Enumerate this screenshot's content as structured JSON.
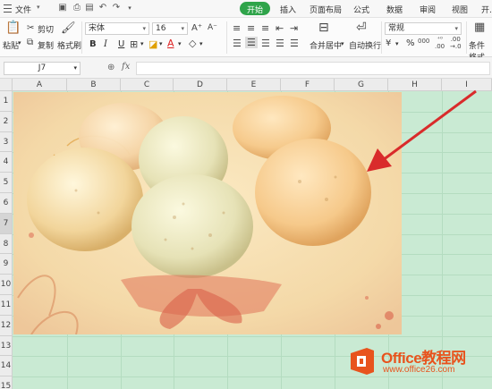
{
  "menubar": {
    "file_label": "文件",
    "tabs": [
      {
        "label": "开始",
        "active": true
      },
      {
        "label": "插入"
      },
      {
        "label": "页面布局"
      },
      {
        "label": "公式"
      },
      {
        "label": "数据"
      },
      {
        "label": "审阅"
      },
      {
        "label": "视图"
      },
      {
        "label": "开..."
      }
    ]
  },
  "ribbon": {
    "paste_label": "粘贴",
    "cut_label": "剪切",
    "copy_label": "复制",
    "format_painter_label": "格式刷",
    "font_name": "宋体",
    "font_size": "16",
    "bold": "B",
    "italic": "I",
    "underline": "U",
    "merge_label": "合并居中",
    "wrap_label": "自动换行",
    "number_format": "常规",
    "percent": "%",
    "conditional_label": "条件格式"
  },
  "formula_bar": {
    "cell_ref": "J7",
    "fx": "fx",
    "formula": ""
  },
  "grid": {
    "columns": [
      "A",
      "B",
      "C",
      "D",
      "E",
      "F",
      "G",
      "H",
      "I"
    ],
    "rows": [
      "1",
      "2",
      "3",
      "4",
      "5",
      "6",
      "7",
      "8",
      "9",
      "10",
      "11",
      "12",
      "13",
      "14",
      "15"
    ],
    "selected_row": "7",
    "fill_color": "#c9ead3"
  },
  "watermark": {
    "brand": "Office教程网",
    "url": "www.office26.com"
  },
  "colors": {
    "accent": "#2fa44a",
    "arrow": "#d92b2b",
    "watermark_logo": "#e8531d"
  }
}
